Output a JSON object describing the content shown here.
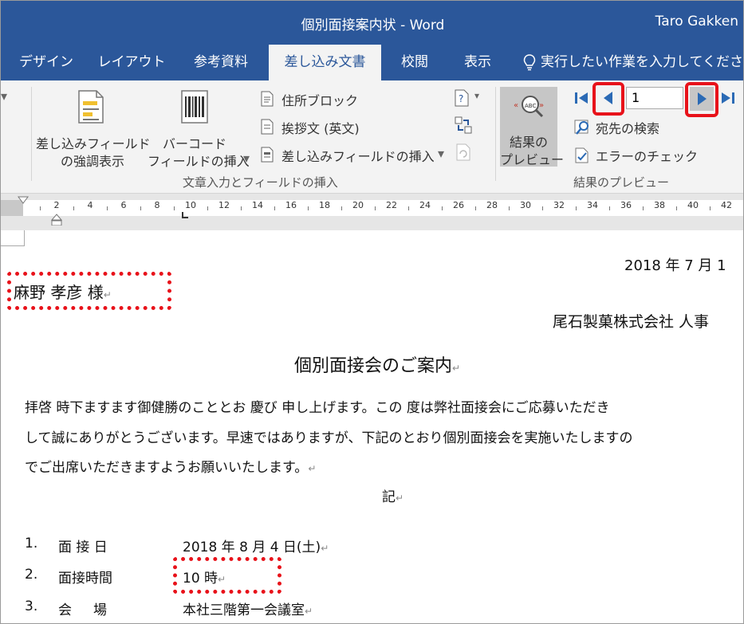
{
  "window": {
    "title": "個別面接案内状 - Word",
    "user": "Taro Gakken"
  },
  "tabs": [
    {
      "label": "デザイン"
    },
    {
      "label": "レイアウト"
    },
    {
      "label": "参考資料"
    },
    {
      "label": "差し込み文書",
      "active": true
    },
    {
      "label": "校閲"
    },
    {
      "label": "表示"
    }
  ],
  "tell_me": "実行したい作業を入力してください",
  "ribbon": {
    "highlight_fields": [
      "差し込みフィールド",
      "の強調表示"
    ],
    "barcode_field": [
      "バーコード",
      "フィールドの挿入"
    ],
    "address_block": "住所ブロック",
    "greeting_line": "挨拶文 (英文)",
    "insert_merge_field": "差し込みフィールドの挿入",
    "group_write_insert": "文章入力とフィールドの挿入",
    "preview_results": [
      "結果の",
      "プレビュー"
    ],
    "record_number": "1",
    "find_recipient": "宛先の検索",
    "check_errors": "エラーのチェック",
    "group_preview": "結果のプレビュー"
  },
  "ruler": {
    "ticks": [
      "2",
      "4",
      "6",
      "8",
      "10",
      "12",
      "14",
      "16",
      "18",
      "20",
      "22",
      "24",
      "26",
      "28",
      "30",
      "32",
      "34",
      "36",
      "38",
      "40",
      "42"
    ]
  },
  "document": {
    "date": "2018 年 7 月 1",
    "recipient": "麻野  孝彦  様",
    "sender": "尾石製菓株式会社  人事",
    "heading": "個別面接会のご案内",
    "body_lines": [
      "拝啓  時下ますます御健勝のこととお 慶び 申し上げます。この 度は弊社面接会にご応募いただき",
      "して誠にありがとうございます。早速ではありますが、下記のとおり個別面接会を実施いたしますの",
      "でご出席いただきますようお願いいたします。"
    ],
    "ki": "記",
    "items": [
      {
        "num": "1.",
        "label": "面 接 日",
        "value": "2018 年 8 月 4 日(土)"
      },
      {
        "num": "2.",
        "label": "面接時間",
        "value": "10 時"
      },
      {
        "num": "3.",
        "label": "会     場",
        "value": "本社三階第一会議室"
      }
    ]
  },
  "colors": {
    "word_blue": "#2b579a",
    "highlight_red": "#e8121a",
    "nav_blue": "#2b6ab5"
  }
}
